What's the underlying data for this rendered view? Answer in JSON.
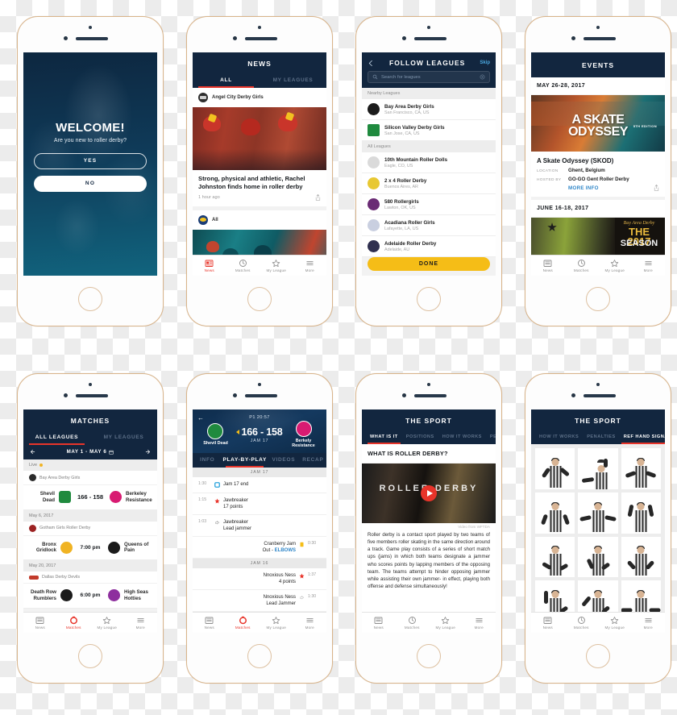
{
  "meta": {
    "screens": 8
  },
  "tabbar": {
    "items": [
      {
        "label": "News",
        "icon": "news-icon"
      },
      {
        "label": "Matches",
        "icon": "matches-icon"
      },
      {
        "label": "My League",
        "icon": "star-icon"
      },
      {
        "label": "More",
        "icon": "hamburger-icon"
      }
    ]
  },
  "accent": {
    "navy": "#12263f",
    "red": "#e8342a",
    "yellow": "#f5bd17",
    "blue_link": "#2f86c8"
  },
  "welcome": {
    "title": "WELCOME!",
    "subtitle": "Are you new to roller derby?",
    "yes_label": "YES",
    "no_label": "NO"
  },
  "news": {
    "header": "NEWS",
    "tabs": [
      {
        "label": "ALL",
        "active": true
      },
      {
        "label": "MY LEAGUES",
        "active": false
      }
    ],
    "items": [
      {
        "source": "Angel City Derby Girls",
        "title": "Strong, physical and athletic, Rachel Johnston finds home in roller derby",
        "time": "1 hour ago"
      },
      {
        "source": "All",
        "title": "",
        "time": ""
      }
    ],
    "tabbar_selected": "News"
  },
  "follow": {
    "header": "FOLLOW LEAGUES",
    "skip_label": "Skip",
    "search_placeholder": "Search for leagues",
    "sections": [
      {
        "title": "Nearby Leagues",
        "leagues": [
          {
            "name": "Bay Area Derby Girls",
            "location": "San Francisco, CA, US",
            "color": "#1b1b1b"
          },
          {
            "name": "Silicon Valley Derby Girls",
            "location": "San Jose, CA, US",
            "color": "#1f8a3e"
          }
        ]
      },
      {
        "title": "All Leagues",
        "leagues": [
          {
            "name": "10th Mountain Roller Dolls",
            "location": "Eagle, CO, US",
            "color": "#d8d8d8"
          },
          {
            "name": "2 x 4 Roller Derby",
            "location": "Buenos Aires, AR",
            "color": "#e8c832"
          },
          {
            "name": "580 Rollergirls",
            "location": "Lawton, OK, US",
            "color": "#6a2b74"
          },
          {
            "name": "Acadiana Roller Girls",
            "location": "Lafayette, LA, US",
            "color": "#c9cfe0"
          },
          {
            "name": "Adelaide Roller Derby",
            "location": "Adelaide, AU",
            "color": "#2f2f4f"
          }
        ]
      }
    ],
    "done_label": "DONE"
  },
  "events": {
    "header": "EVENTS",
    "groups": [
      {
        "date": "MAY 26-28, 2017",
        "poster_line1": "A SKATE",
        "poster_line2": "ODYSSEY",
        "poster_badge": "5TH EDITION",
        "name": "A Skate Odyssey (SKOD)",
        "location_label": "LOCATION",
        "location": "Ghent, Belgium",
        "hosted_label": "HOSTED BY",
        "hosted_by": "GO-GO Gent Roller Derby",
        "more_info": "MORE INFO"
      },
      {
        "date": "JUNE 16-18, 2017",
        "poster_line1": "THE 2017",
        "poster_line2": "SEASON",
        "poster_badge": "Bay Area Derby"
      }
    ]
  },
  "matches": {
    "header": "MATCHES",
    "tabs": [
      {
        "label": "ALL LEAGUES",
        "active": true
      },
      {
        "label": "MY LEAGUES",
        "active": false
      }
    ],
    "date_range": "MAY 1 - MAY 6",
    "groups": [
      {
        "label": "Live",
        "live": true,
        "league": "Bay Area Derby Girls",
        "league_color": "#2b2b2b",
        "match": {
          "home": "Shevil Dead",
          "away": "Berkeley Resistance",
          "home_color": "#1f8a3e",
          "away_color": "#d81b72",
          "center": "166 - 158",
          "is_score": true
        }
      },
      {
        "label": "May 6, 2017",
        "live": false,
        "league": "Gotham Girls Roller Derby",
        "league_color": "#9c2222",
        "match": {
          "home": "Bronx Gridlock",
          "away": "Queens of Pain",
          "home_color": "#f0b323",
          "away_color": "#1b1b1b",
          "center": "7:00 pm",
          "is_score": false
        }
      },
      {
        "label": "May 20, 2017",
        "live": false,
        "league": "Dallas Derby Devils",
        "league_color": "#c23a2a",
        "match": {
          "home": "Death Row Rumblers",
          "away": "High Seas Hotties",
          "home_color": "#1b1b1b",
          "away_color": "#8e2f9e",
          "center": "6:00 pm",
          "is_score": false
        }
      }
    ]
  },
  "playbyplay": {
    "period_clock": "P1 20:57",
    "score": "166 - 158",
    "jam_label": "JAM 17",
    "home_team": "Shevil Dead",
    "away_team": "Berkely Resistance",
    "home_color": "#1f8a3e",
    "away_color": "#d81b72",
    "tabs": [
      {
        "label": "INFO",
        "active": false
      },
      {
        "label": "PLAY-BY-PLAY",
        "active": true
      },
      {
        "label": "VIDEOS",
        "active": false
      },
      {
        "label": "RECAP",
        "active": false
      }
    ],
    "sections": [
      {
        "jam": "JAM 17",
        "events": [
          {
            "time": "1:30",
            "text": "Jam 17 end",
            "side": "left",
            "icon": "jam-end-icon",
            "icon_color": "#29a3dc"
          },
          {
            "time": "1:15",
            "text": "Jawbreaker",
            "text2": "17 points",
            "side": "left",
            "icon": "star-icon",
            "icon_color": "#e8342a"
          },
          {
            "time": "1:03",
            "text": "Jawbreaker",
            "text2": "Lead jammer",
            "side": "left",
            "icon": "lead-jammer-icon",
            "icon_color": "#9a9a9a"
          },
          {
            "time": "0:30",
            "text": "Cranberry Jam",
            "text2": "Out - ELBOWS",
            "side": "right",
            "icon": "penalty-icon",
            "icon_color": "#f5bd17",
            "link": "ELBOWS"
          }
        ]
      },
      {
        "jam": "JAM 16",
        "events": [
          {
            "time": "1:37",
            "text": "Nnoxious Ness",
            "text2": "4 points",
            "side": "right",
            "icon": "star-icon",
            "icon_color": "#e8342a"
          },
          {
            "time": "1:30",
            "text": "Nnoxious Ness",
            "text2": "Lead Jammer",
            "side": "right",
            "icon": "lead-jammer-icon",
            "icon_color": "#9a9a9a"
          }
        ]
      }
    ]
  },
  "sport_whatisit": {
    "header": "THE SPORT",
    "tabs": [
      {
        "label": "WHAT IS IT",
        "active": true
      },
      {
        "label": "POSITIONS",
        "active": false
      },
      {
        "label": "HOW IT WORKS",
        "active": false
      },
      {
        "label": "PE",
        "active": false
      }
    ],
    "section_title": "WHAT IS ROLLER DERBY?",
    "video_word": "ROLLER DERBY",
    "video_credit": "Video from WFTDA",
    "body": "Roller derby is a contact sport played by two teams of five members roller skating in the same direction around a track. Game play consists of a series of short match ups (jams) in which both teams designate a jammer who scores points by lapping members of the opposing team. The teams attempt to hinder opposing jammer while assisting their own jammer- in effect, playing both offense and defense simultaneously!"
  },
  "sport_refsignals": {
    "header": "THE SPORT",
    "tabs": [
      {
        "label": "HOW IT WORKS",
        "active": false
      },
      {
        "label": "PENALTIES",
        "active": false
      },
      {
        "label": "REF HAND SIGNALS",
        "active": true
      }
    ],
    "signal_count": 15
  }
}
